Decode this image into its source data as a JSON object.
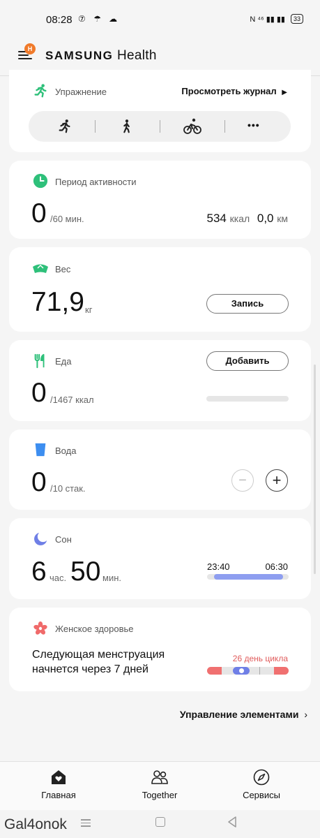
{
  "status": {
    "time": "08:28",
    "left_icons": "⑦ ☂ ☁",
    "right_icons": "N ⁴⁶ ▮▮ ▮▮",
    "battery": "33"
  },
  "app": {
    "badge": "H",
    "brand": "SAMSUNG",
    "name": "Health"
  },
  "exercise": {
    "title": "Упражнение",
    "journal_link": "Просмотреть журнал",
    "types": [
      "run",
      "walk",
      "cycle",
      "more"
    ],
    "more_glyph": "•••"
  },
  "activity": {
    "title": "Период активности",
    "value": "0",
    "target": "/60 мин.",
    "kcal_value": "534",
    "kcal_unit": "ккал",
    "km_value": "0,0",
    "km_unit": "км"
  },
  "weight": {
    "title": "Вес",
    "value": "71,9",
    "unit": "кг",
    "button": "Запись"
  },
  "food": {
    "title": "Еда",
    "value": "0",
    "target": "/1467 ккал",
    "button": "Добавить"
  },
  "water": {
    "title": "Вода",
    "value": "0",
    "target": "/10 стак.",
    "minus": "−",
    "plus": "+"
  },
  "sleep": {
    "title": "Сон",
    "hours": "6",
    "hours_unit": "час.",
    "minutes": "50",
    "minutes_unit": "мин.",
    "start": "23:40",
    "end": "06:30",
    "bar_color": "#8e9ef0"
  },
  "women": {
    "title": "Женское здоровье",
    "text_line1": "Следующая менструация",
    "text_line2": "начнется через 7 дней",
    "cycle_day": "26 день цикла",
    "accent": "#e05a5a"
  },
  "manage": {
    "label": "Управление элементами"
  },
  "nav": {
    "home": "Главная",
    "together": "Together",
    "services": "Сервисы"
  },
  "sys": {
    "watermark": "Gal4onok"
  },
  "colors": {
    "green": "#2ec07a",
    "water_blue": "#3d8ef0",
    "sleep_purple": "#6f7fe6"
  }
}
